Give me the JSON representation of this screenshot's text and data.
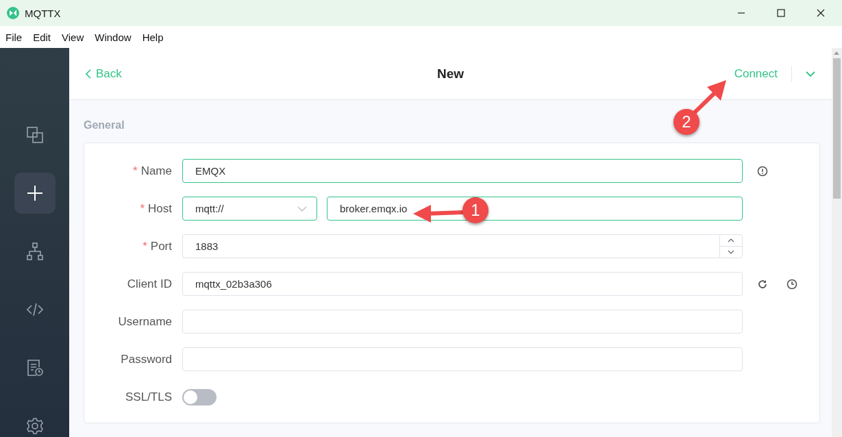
{
  "window": {
    "title": "MQTTX"
  },
  "menu": [
    "File",
    "Edit",
    "View",
    "Window",
    "Help"
  ],
  "sidebar": {
    "items": [
      {
        "kind": "connections",
        "selected": false
      },
      {
        "kind": "new",
        "selected": true
      },
      {
        "kind": "topology",
        "selected": false
      },
      {
        "kind": "script",
        "selected": false
      },
      {
        "kind": "log",
        "selected": false
      },
      {
        "kind": "settings",
        "selected": false
      }
    ]
  },
  "header": {
    "back": "Back",
    "title": "New",
    "connect": "Connect"
  },
  "section": "General",
  "fields": [
    {
      "kind": "text",
      "required_mark": "*",
      "label": "Name",
      "active": true,
      "value": "EMQX",
      "actions": [
        {
          "kind": "info"
        }
      ]
    },
    {
      "kind": "host",
      "required_mark": "*",
      "label": "Host",
      "active": true,
      "protocol": "mqtt://",
      "value": "broker.emqx.io"
    },
    {
      "kind": "number",
      "required_mark": "*",
      "label": "Port",
      "active": false,
      "value": "1883"
    },
    {
      "kind": "text",
      "label": "Client ID",
      "active": false,
      "value": "mqttx_02b3a306",
      "actions": [
        {
          "kind": "refresh"
        },
        {
          "kind": "history"
        }
      ]
    },
    {
      "kind": "text",
      "label": "Username",
      "active": false
    },
    {
      "kind": "text",
      "label": "Password",
      "active": false
    },
    {
      "kind": "switch",
      "label": "SSL/TLS",
      "on": false
    }
  ],
  "annotations": [
    {
      "label": "1"
    },
    {
      "label": "2"
    }
  ]
}
